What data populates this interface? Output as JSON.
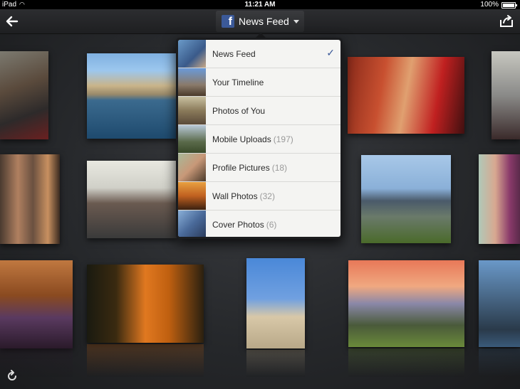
{
  "status_bar": {
    "carrier": "iPad",
    "time": "11:21 AM",
    "battery": "100%"
  },
  "nav": {
    "title": "News Feed",
    "logo_letter": "f",
    "back_icon": "back-arrow-icon",
    "share_icon": "share-icon",
    "refresh_icon": "refresh-icon"
  },
  "menu": {
    "items": [
      {
        "label": "News Feed",
        "count": "",
        "selected": true
      },
      {
        "label": "Your Timeline",
        "count": "",
        "selected": false
      },
      {
        "label": "Photos of You",
        "count": "",
        "selected": false
      },
      {
        "label": "Mobile Uploads",
        "count": "(197)",
        "selected": false
      },
      {
        "label": "Profile Pictures",
        "count": "(18)",
        "selected": false
      },
      {
        "label": "Wall Photos",
        "count": "(32)",
        "selected": false
      },
      {
        "label": "Cover Photos",
        "count": "(6)",
        "selected": false
      }
    ],
    "check_mark": "✓"
  },
  "colors": {
    "facebook_blue": "#3b5998",
    "background": "#26282b"
  }
}
